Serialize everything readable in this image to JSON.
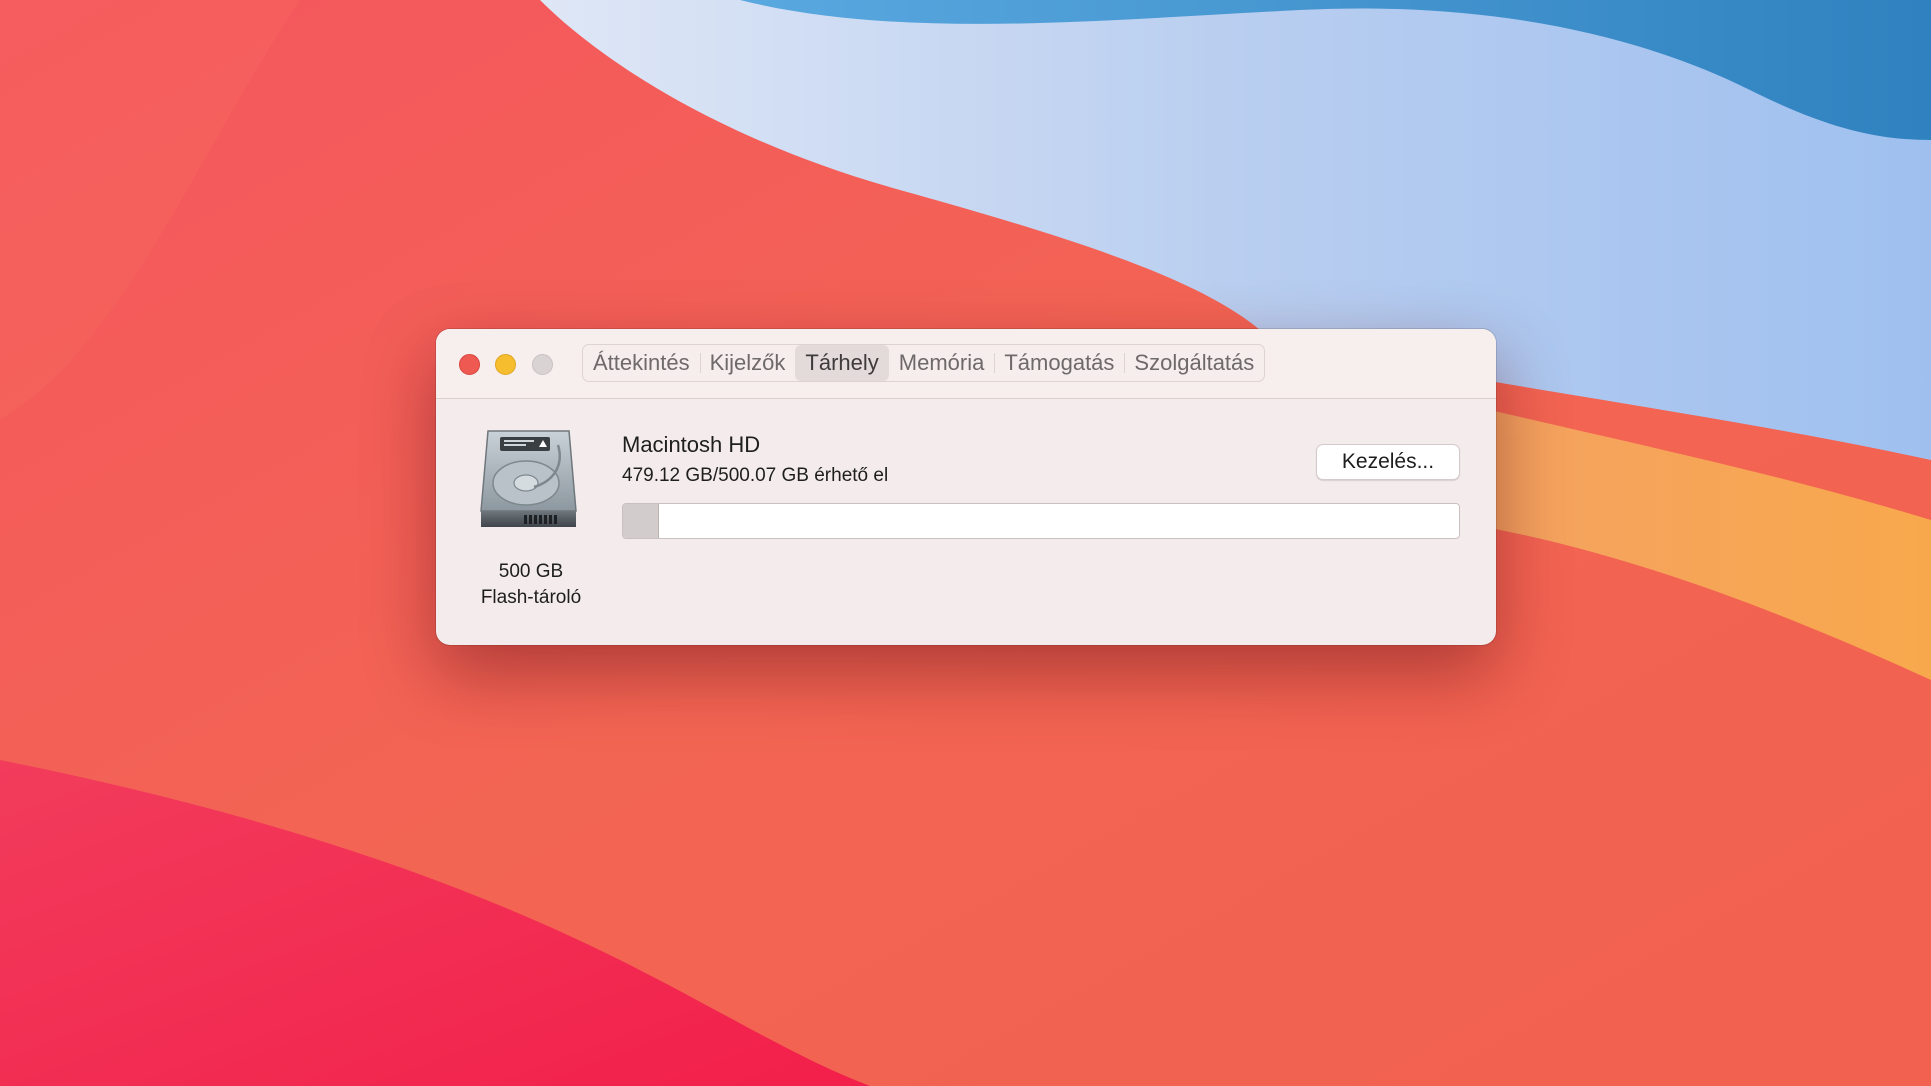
{
  "window": {
    "tabs": [
      {
        "label": "Áttekintés",
        "active": false
      },
      {
        "label": "Kijelzők",
        "active": false
      },
      {
        "label": "Tárhely",
        "active": true
      },
      {
        "label": "Memória",
        "active": false
      },
      {
        "label": "Támogatás",
        "active": false
      },
      {
        "label": "Szolgáltatás",
        "active": false
      }
    ],
    "traffic_lights": {
      "close": "#ee5a52",
      "minimize": "#f6be2f",
      "zoom": "#d9d3d3"
    }
  },
  "storage": {
    "disk_icon": "hard-drive-icon",
    "disk_size": "500 GB",
    "disk_type": "Flash-tároló",
    "volume_name": "Macintosh HD",
    "availability": "479.12 GB/500.07 GB érhető el",
    "manage_label": "Kezelés...",
    "used_gb": 20.95,
    "total_gb": 500.07
  },
  "colors": {
    "accent": "#e3dada",
    "window_bg": "#f4ecec",
    "usage_fill": "#d2cccc"
  }
}
